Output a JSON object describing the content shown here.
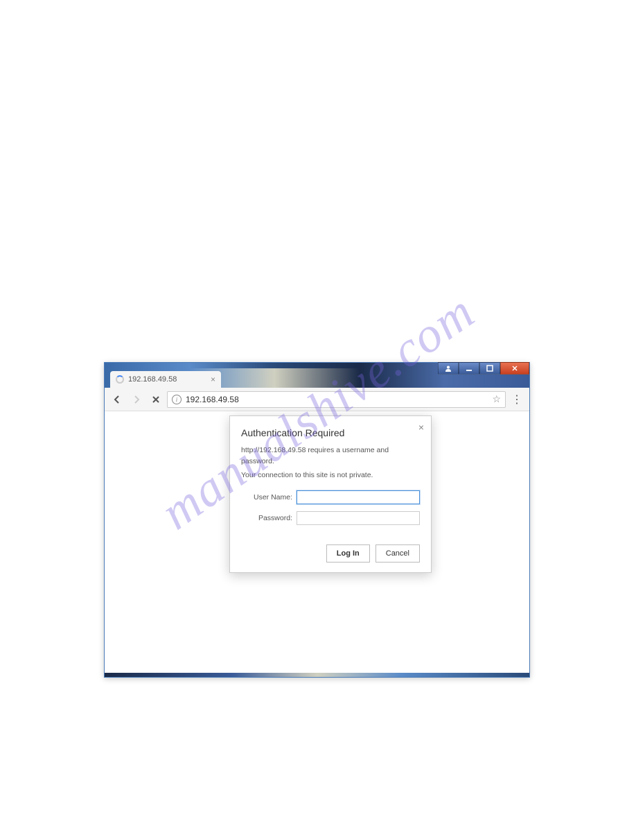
{
  "watermark": "manualshive.com",
  "window": {
    "tab_title": "192.168.49.58",
    "address_url": "192.168.49.58"
  },
  "dialog": {
    "title": "Authentication Required",
    "line1": "http://192.168.49.58 requires a username and password.",
    "line2": "Your connection to this site is not private.",
    "username_label": "User Name:",
    "password_label": "Password:",
    "username_value": "",
    "password_value": "",
    "login_label": "Log In",
    "cancel_label": "Cancel"
  }
}
